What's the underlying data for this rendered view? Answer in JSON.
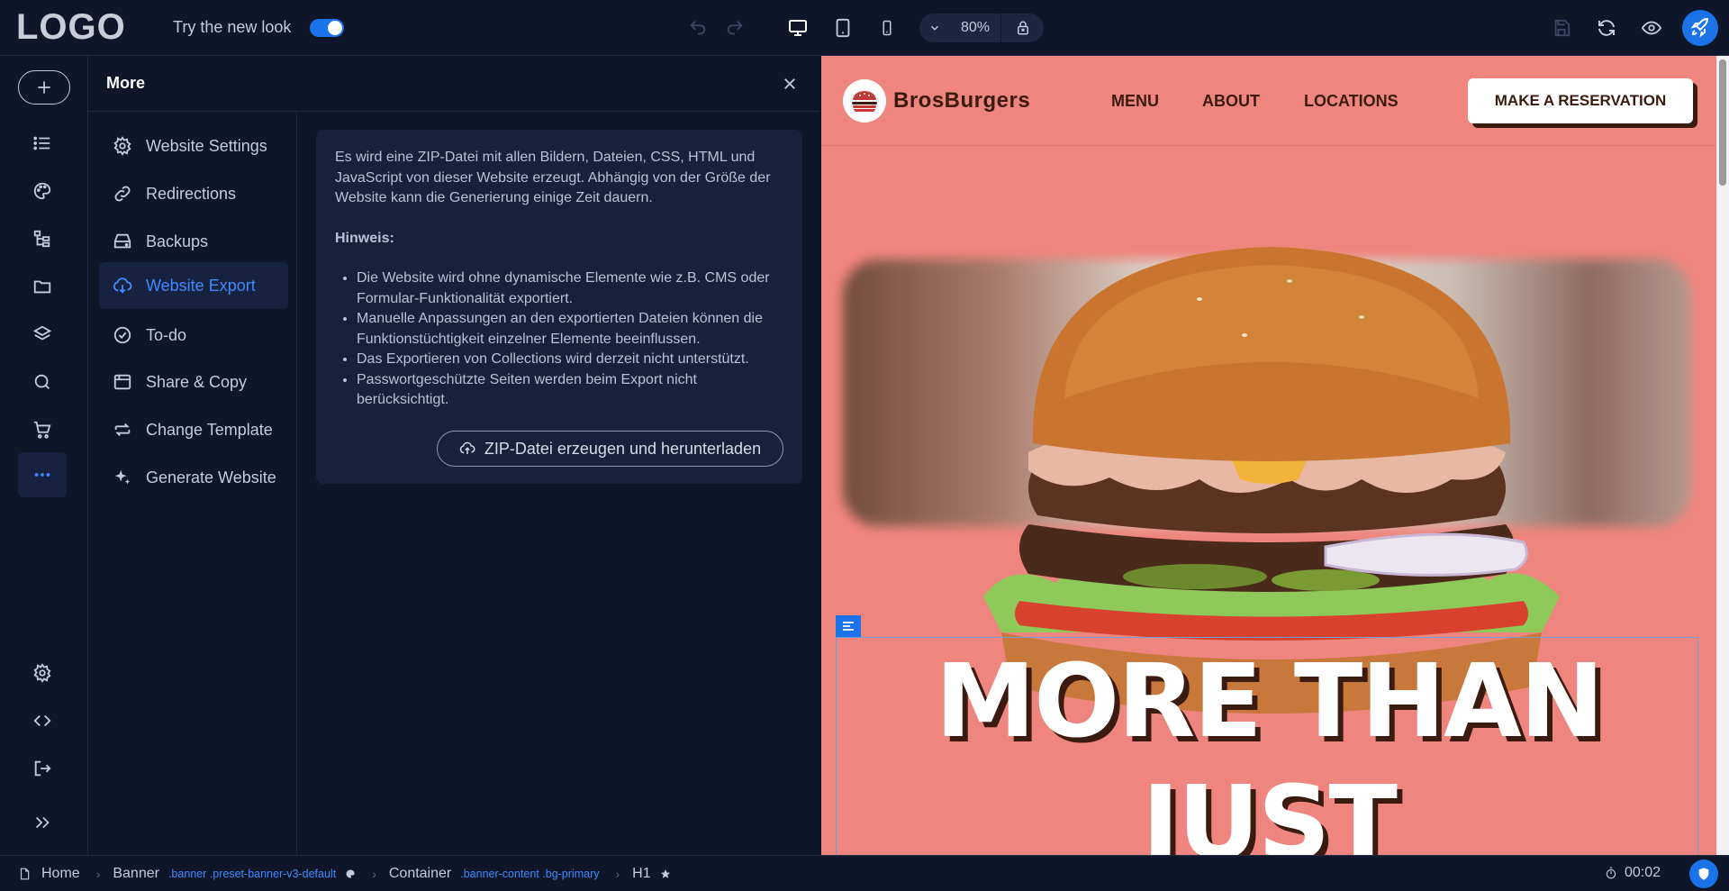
{
  "topbar": {
    "logo": "LOGO",
    "new_look_label": "Try the new look",
    "new_look_enabled": true,
    "zoom_value": "80%"
  },
  "more_panel": {
    "title": "More",
    "menu": [
      {
        "label": "Website Settings",
        "icon": "gear-icon"
      },
      {
        "label": "Redirections",
        "icon": "link-icon"
      },
      {
        "label": "Backups",
        "icon": "drive-icon"
      },
      {
        "label": "Website Export",
        "icon": "cloud-download-icon",
        "active": true
      },
      {
        "label": "To-do",
        "icon": "check-circle-icon"
      },
      {
        "label": "Share & Copy",
        "icon": "copy-icon"
      },
      {
        "label": "Change Template",
        "icon": "swap-icon"
      },
      {
        "label": "Generate Website",
        "icon": "sparkle-icon"
      }
    ],
    "export": {
      "intro": "Es wird eine ZIP-Datei mit allen Bildern, Dateien, CSS, HTML und JavaScript von dieser Website erzeugt. Abhängig von der Größe der Website kann die Generierung einige Zeit dauern.",
      "hint_title": "Hinweis:",
      "notes": [
        "Die Website wird ohne dynamische Elemente wie z.B. CMS oder Formular-Funktionalität exportiert.",
        "Manuelle Anpassungen an den exportierten Dateien können die Funktionstüchtigkeit einzelner Elemente beeinflussen.",
        "Das Exportieren von Collections wird derzeit nicht unterstützt.",
        "Passwortgeschützte Seiten werden beim Export nicht berücksichtigt."
      ],
      "button_label": "ZIP-Datei erzeugen und herunterladen"
    }
  },
  "preview": {
    "brand": "BrosBurgers",
    "nav": [
      "MENU",
      "ABOUT",
      "LOCATIONS"
    ],
    "cta": "MAKE A RESERVATION",
    "headline_line1": "MORE THAN",
    "headline_line2": "JUST"
  },
  "bottombar": {
    "crumbs": [
      {
        "label": "Home",
        "classes": ""
      },
      {
        "label": "Banner",
        "classes": ".banner .preset-banner-v3-default"
      },
      {
        "label": "Container",
        "classes": ".banner-content .bg-primary"
      },
      {
        "label": "H1",
        "classes": ""
      }
    ],
    "timer": "00:02"
  },
  "colors": {
    "accent": "#1a73e8",
    "preview_bg": "#ee857e",
    "brand_dark": "#3b1b10"
  }
}
